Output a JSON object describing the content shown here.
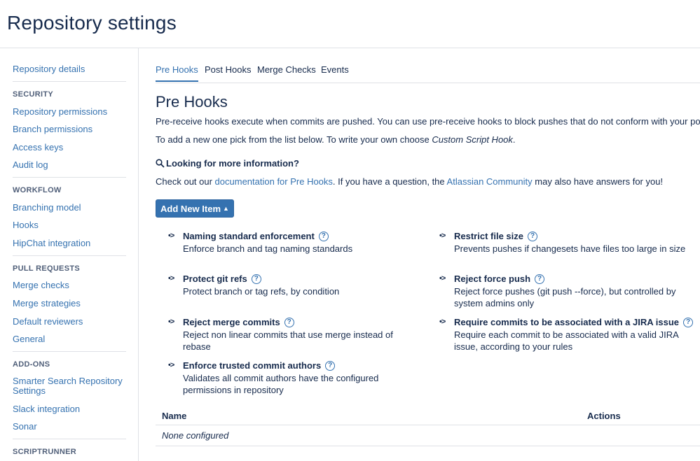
{
  "page": {
    "title": "Repository settings"
  },
  "sidebar": {
    "top_link": "Repository details",
    "sections": [
      {
        "heading": "SECURITY",
        "items": [
          "Repository permissions",
          "Branch permissions",
          "Access keys",
          "Audit log"
        ]
      },
      {
        "heading": "WORKFLOW",
        "items": [
          "Branching model",
          "Hooks",
          "HipChat integration"
        ]
      },
      {
        "heading": "PULL REQUESTS",
        "items": [
          "Merge checks",
          "Merge strategies",
          "Default reviewers",
          "General"
        ]
      },
      {
        "heading": "ADD-ONS",
        "items": [
          "Smarter Search Repository Settings",
          "Slack integration",
          "Sonar"
        ]
      },
      {
        "heading": "SCRIPTRUNNER",
        "items": []
      }
    ]
  },
  "tabs": [
    {
      "label": "Pre Hooks",
      "active": true
    },
    {
      "label": "Post Hooks",
      "active": false
    },
    {
      "label": "Merge Checks",
      "active": false
    },
    {
      "label": "Events",
      "active": false
    }
  ],
  "main": {
    "title": "Pre Hooks",
    "intro": "Pre-receive hooks execute when commits are pushed. You can use pre-receive hooks to block pushes that do not conform with your policies.",
    "custom_prefix": "To add a new one pick from the list below. To write your own choose ",
    "custom_name": "Custom Script Hook",
    "custom_suffix": ".",
    "info_heading": "Looking for more information?",
    "info_prefix": "Check out our ",
    "info_link_docs": "documentation for Pre Hooks",
    "info_middle": ". If you have a question, the ",
    "info_link_community": "Atlassian Community",
    "info_suffix": " may also have answers for you!",
    "add_button": "Add New Item",
    "help_glyph": "?",
    "bullet_glyph": "•>"
  },
  "hooks": [
    {
      "name": "Naming standard enforcement",
      "desc": "Enforce branch and tag naming standards"
    },
    {
      "name": "Restrict file size",
      "desc": "Prevents pushes if changesets have files too large in size"
    },
    {
      "name": "Protect git refs",
      "desc": "Protect branch or tag refs, by condition"
    },
    {
      "name": "Reject force push",
      "desc": "Reject force pushes (git push --force), but controlled by system admins only"
    },
    {
      "name": "Reject merge commits",
      "desc": "Reject non linear commits that use merge instead of rebase"
    },
    {
      "name": "Require commits to be associated with a JIRA issue",
      "desc": "Require each commit to be associated with a valid JIRA issue, according to your rules"
    },
    {
      "name": "Enforce trusted commit authors",
      "desc": "Validates all commit authors have the configured permissions in repository"
    }
  ],
  "table": {
    "columns": [
      "Name",
      "Actions"
    ],
    "empty_text": "None configured"
  }
}
